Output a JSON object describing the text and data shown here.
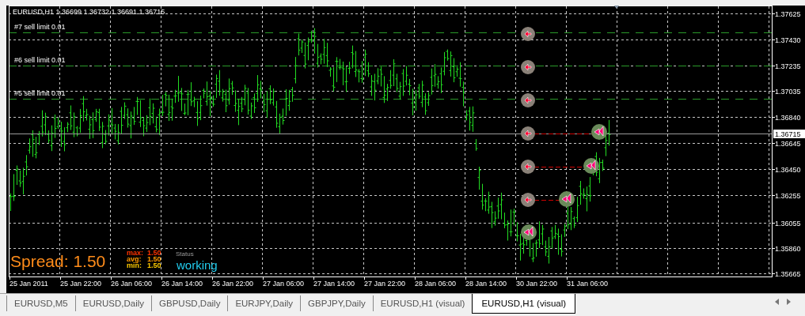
{
  "chart": {
    "title": "EURUSD,H1  1.36699 1.36732 1.36691 1.36715",
    "orders": [
      {
        "label": "#7 sell limit 0.01"
      },
      {
        "label": "#6 sell limit 0.01"
      },
      {
        "label": "#5 sell limit 0.01"
      }
    ],
    "price_axis": [
      "1.37625",
      "1.37430",
      "1.37235",
      "1.37035",
      "1.36840",
      "1.36645",
      "1.36450",
      "1.36255",
      "1.36055",
      "1.35860",
      "1.35665"
    ],
    "current_price": "1.36715",
    "time_axis": [
      "25 Jan 2011",
      "25 Jan 22:00",
      "26 Jan 06:00",
      "26 Jan 14:00",
      "26 Jan 22:00",
      "27 Jan 06:00",
      "27 Jan 14:00",
      "27 Jan 22:00",
      "28 Jan 06:00",
      "28 Jan 14:00",
      "30 Jan 22:00",
      "31 Jan 06:00"
    ],
    "spread": {
      "text": "Spread: 1.50",
      "stats": [
        {
          "label": "max:",
          "value": "1.50",
          "color": "#ff3300"
        },
        {
          "label": "avg:",
          "value": "1.50",
          "color": "#ff9900"
        },
        {
          "label": "min:",
          "value": "1.50",
          "color": "#ffcc00"
        }
      ]
    },
    "status": {
      "label": "Status",
      "value": "working"
    }
  },
  "tabs": [
    {
      "label": "EURUSD,M5",
      "selected": false
    },
    {
      "label": "EURUSD,Daily",
      "selected": false
    },
    {
      "label": "GBPUSD,Daily",
      "selected": false
    },
    {
      "label": "EURJPY,Daily",
      "selected": false
    },
    {
      "label": "GBPJPY,Daily",
      "selected": false
    },
    {
      "label": "EURUSD,H1 (visual)",
      "selected": false
    },
    {
      "label": "EURUSD,H1 (visual)",
      "selected": true
    }
  ]
}
